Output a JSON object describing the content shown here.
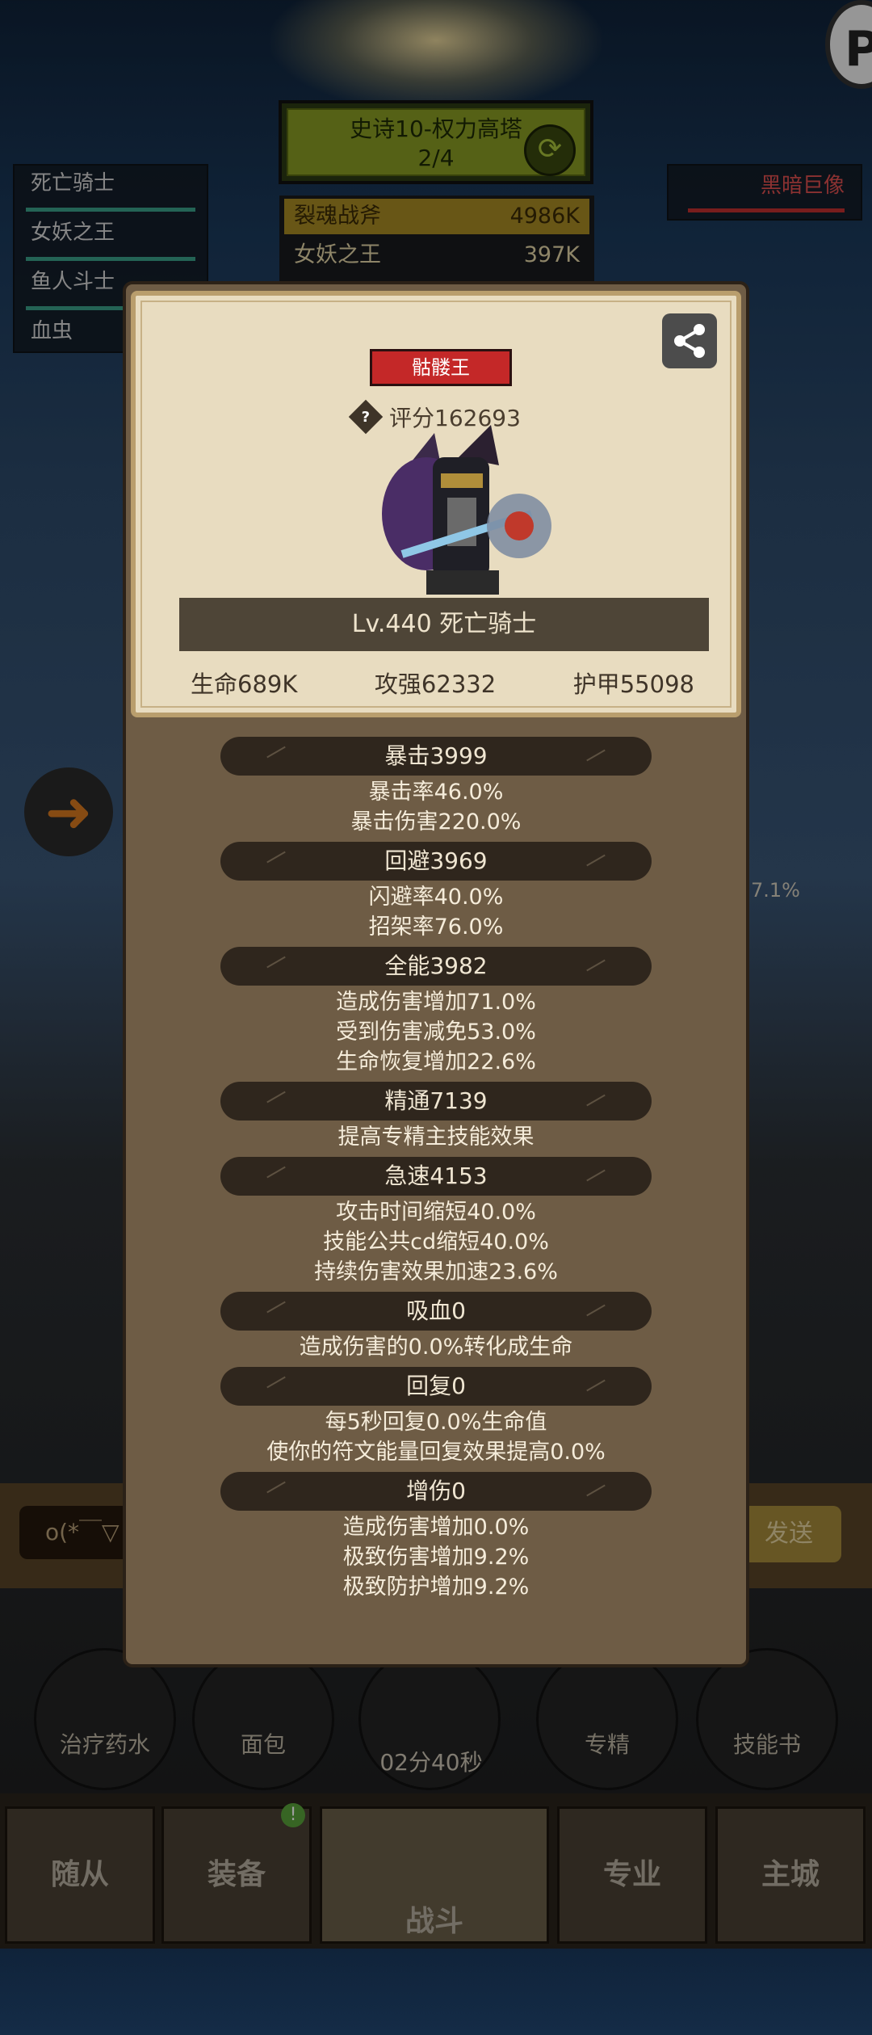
{
  "stage": {
    "title": "史诗10-权力高塔",
    "progress": "2/4"
  },
  "party": [
    "死亡骑士",
    "女妖之王",
    "鱼人斗士",
    "血虫"
  ],
  "boss": {
    "name": "黑暗巨像"
  },
  "damage": [
    {
      "name": "裂魂战斧",
      "value": "4986K"
    },
    {
      "name": "女妖之王",
      "value": "397K"
    }
  ],
  "chat": {
    "placeholder": "o(*￣▽",
    "send": "发送"
  },
  "items": [
    {
      "label": "治疗药水"
    },
    {
      "label": "面包"
    },
    {
      "label": "02分40秒"
    },
    {
      "label": "专精"
    },
    {
      "label": "技能书"
    }
  ],
  "nav": {
    "followers": "随从",
    "equipment": "装备",
    "battle": "战斗",
    "profession": "专业",
    "main_city": "主城",
    "badge": "!"
  },
  "hero": {
    "title_tag": "骷髅王",
    "score": "评分162693",
    "level_name": "Lv.440 死亡骑士",
    "hp": "生命689K",
    "attack": "攻强62332",
    "armor": "护甲55098"
  },
  "stats": [
    {
      "head": "暴击3999",
      "lines": [
        "暴击率46.0%",
        "暴击伤害220.0%"
      ]
    },
    {
      "head": "回避3969",
      "lines": [
        "闪避率40.0%",
        "招架率76.0%"
      ]
    },
    {
      "head": "全能3982",
      "lines": [
        "造成伤害增加71.0%",
        "受到伤害减免53.0%",
        "生命恢复增加22.6%"
      ]
    },
    {
      "head": "精通7139",
      "lines": [
        "提高专精主技能效果"
      ]
    },
    {
      "head": "急速4153",
      "lines": [
        "攻击时间缩短40.0%",
        "技能公共cd缩短40.0%",
        "持续伤害效果加速23.6%"
      ]
    },
    {
      "head": "吸血0",
      "lines": [
        "造成伤害的0.0%转化成生命"
      ]
    },
    {
      "head": "回复0",
      "lines": [
        "每5秒回复0.0%生命值",
        "使你的符文能量回复效果提高0.0%"
      ]
    },
    {
      "head": "增伤0",
      "lines": [
        "造成伤害增加0.0%",
        "极致伤害增加9.2%",
        "极致防护增加9.2%"
      ]
    }
  ],
  "side_percent": "7.1%"
}
